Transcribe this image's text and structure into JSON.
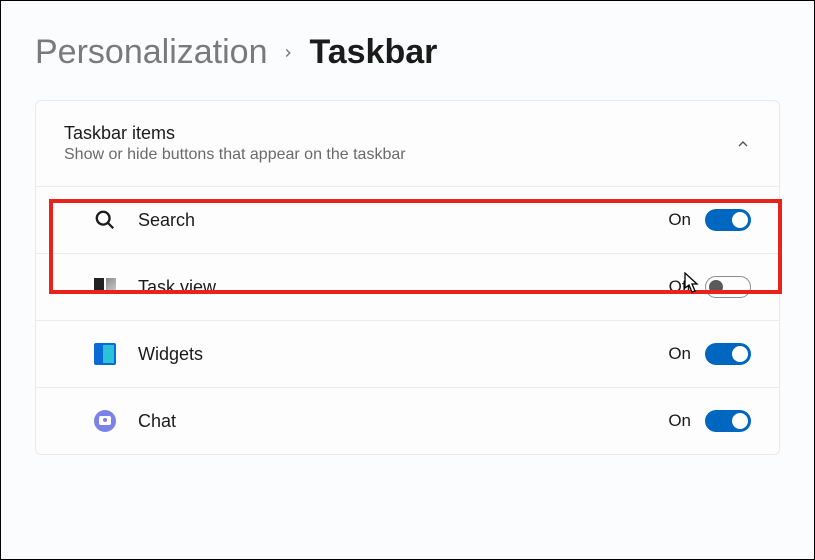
{
  "breadcrumb": {
    "parent": "Personalization",
    "current": "Taskbar"
  },
  "section": {
    "title": "Taskbar items",
    "subtitle": "Show or hide buttons that appear on the taskbar"
  },
  "items": [
    {
      "icon": "search-icon",
      "label": "Search",
      "state_label": "On",
      "on": true,
      "highlighted": true
    },
    {
      "icon": "taskview-icon",
      "label": "Task view",
      "state_label": "Off",
      "on": false,
      "highlighted": false
    },
    {
      "icon": "widgets-icon",
      "label": "Widgets",
      "state_label": "On",
      "on": true,
      "highlighted": false
    },
    {
      "icon": "chat-icon",
      "label": "Chat",
      "state_label": "On",
      "on": true,
      "highlighted": false
    }
  ]
}
